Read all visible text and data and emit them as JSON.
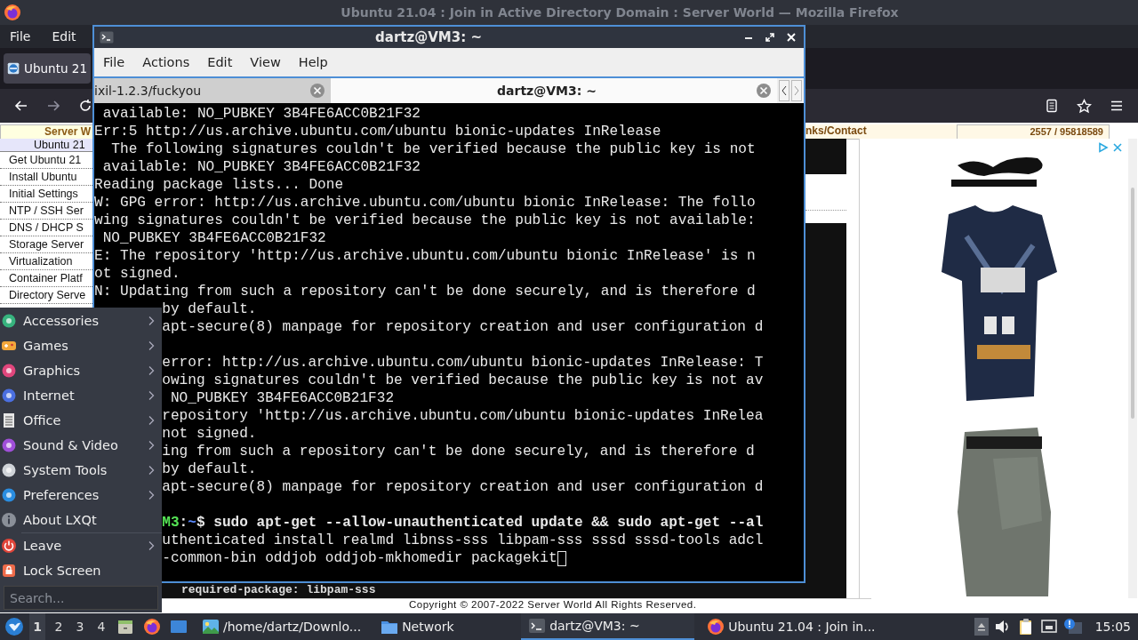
{
  "firefox": {
    "title": "Ubuntu 21.04 : Join in Active Directory Domain : Server World — Mozilla Firefox",
    "menu": [
      "File",
      "Edit"
    ],
    "tabs": [
      {
        "label": "Ubuntu 21",
        "selected": true
      }
    ],
    "page": {
      "header_left": "Server W",
      "header_links": "nks/Contact",
      "header_counter": "2557 / 95818589",
      "nav": [
        {
          "label": "Ubuntu 21",
          "selected": true
        },
        {
          "label": "Get Ubuntu 21",
          "selected": false
        },
        {
          "label": "Install Ubuntu",
          "selected": false
        },
        {
          "label": "Initial Settings",
          "selected": false
        },
        {
          "label": "NTP / SSH Ser",
          "selected": false
        },
        {
          "label": "DNS / DHCP S",
          "selected": false
        },
        {
          "label": "Storage Server",
          "selected": false
        },
        {
          "label": "Virtualization",
          "selected": false
        },
        {
          "label": "Container Platf",
          "selected": false
        },
        {
          "label": "Directory Serve",
          "selected": false
        }
      ],
      "content_line": "required-package: libpam-sss",
      "copyright": "Copyright © 2007-2022 Server World All Rights Reserved."
    }
  },
  "terminal": {
    "title": "dartz@VM3: ~",
    "menu": [
      "File",
      "Actions",
      "Edit",
      "View",
      "Help"
    ],
    "tabs": [
      {
        "label": "ixil-1.2.3/fuckyou",
        "selected": false
      },
      {
        "label": "dartz@VM3: ~",
        "selected": true
      }
    ],
    "lines": [
      {
        "kind": "line",
        "text": " available: NO_PUBKEY 3B4FE6ACC0B21F32"
      },
      {
        "kind": "line",
        "text": "Err:5 http://us.archive.ubuntu.com/ubuntu bionic-updates InRelease"
      },
      {
        "kind": "line",
        "text": "  The following signatures couldn't be verified because the public key is not"
      },
      {
        "kind": "line",
        "text": " available: NO_PUBKEY 3B4FE6ACC0B21F32"
      },
      {
        "kind": "line",
        "text": "Reading package lists... Done"
      },
      {
        "kind": "line",
        "text": "W: GPG error: http://us.archive.ubuntu.com/ubuntu bionic InRelease: The follo"
      },
      {
        "kind": "line",
        "text": "wing signatures couldn't be verified because the public key is not available:"
      },
      {
        "kind": "line",
        "text": " NO_PUBKEY 3B4FE6ACC0B21F32"
      },
      {
        "kind": "line",
        "text": "E: The repository 'http://us.archive.ubuntu.com/ubuntu bionic InRelease' is n"
      },
      {
        "kind": "line",
        "text": "ot signed."
      },
      {
        "kind": "line",
        "text": "N: Updating from such a repository can't be done securely, and is therefore d"
      },
      {
        "kind": "covered",
        "text": "by default."
      },
      {
        "kind": "covered",
        "text": "apt-secure(8) manpage for repository creation and user configuration d"
      },
      {
        "kind": "blank"
      },
      {
        "kind": "covered",
        "text": "error: http://us.archive.ubuntu.com/ubuntu bionic-updates InRelease: T"
      },
      {
        "kind": "covered",
        "text": "owing signatures couldn't be verified because the public key is not av"
      },
      {
        "kind": "covered",
        "text": " NO_PUBKEY 3B4FE6ACC0B21F32"
      },
      {
        "kind": "covered",
        "text": "repository 'http://us.archive.ubuntu.com/ubuntu bionic-updates InRelea"
      },
      {
        "kind": "covered",
        "text": "not signed."
      },
      {
        "kind": "covered",
        "text": "ing from such a repository can't be done securely, and is therefore d"
      },
      {
        "kind": "covered",
        "text": "by default."
      },
      {
        "kind": "covered",
        "text": "apt-secure(8) manpage for repository creation and user configuration d"
      },
      {
        "kind": "blank"
      },
      {
        "kind": "prompt",
        "segments": [
          {
            "text": "M3",
            "color": "#55e355"
          },
          {
            "text": ":",
            "color": "#e8e8e8"
          },
          {
            "text": "~",
            "color": "#5c8bff"
          },
          {
            "text": "$ sudo apt-get --allow-unauthenticated update && sudo apt-get --al",
            "color": "#e8e8e8"
          }
        ]
      },
      {
        "kind": "covered",
        "text": "uthenticated install realmd libnss-sss libpam-sss sssd sssd-tools adcl"
      },
      {
        "kind": "covered",
        "text": "-common-bin oddjob oddjob-mkhomedir packagekit",
        "cursor": true
      }
    ]
  },
  "start_menu": {
    "items": [
      {
        "kind": "entry",
        "label": "Accessories",
        "submenu": true
      },
      {
        "kind": "entry",
        "label": "Games",
        "submenu": true
      },
      {
        "kind": "entry",
        "label": "Graphics",
        "submenu": true
      },
      {
        "kind": "entry",
        "label": "Internet",
        "submenu": true
      },
      {
        "kind": "entry",
        "label": "Office",
        "submenu": true
      },
      {
        "kind": "entry",
        "label": "Sound & Video",
        "submenu": true
      },
      {
        "kind": "entry",
        "label": "System Tools",
        "submenu": true
      },
      {
        "kind": "entry",
        "label": "Preferences",
        "submenu": true
      },
      {
        "kind": "entry",
        "label": "About LXQt",
        "submenu": false
      },
      {
        "kind": "separator"
      },
      {
        "kind": "entry",
        "label": "Leave",
        "submenu": true
      },
      {
        "kind": "entry",
        "label": "Lock Screen",
        "submenu": false
      }
    ],
    "search": {
      "placeholder": "Search..."
    }
  },
  "taskbar": {
    "desktops": [
      {
        "label": "1",
        "selected": true
      },
      {
        "label": "2",
        "selected": false
      },
      {
        "label": "3",
        "selected": false
      },
      {
        "label": "4",
        "selected": false
      }
    ],
    "tasks": [
      {
        "label": "/home/dartz/Downlo...",
        "selected": false
      },
      {
        "label": "Network",
        "selected": false
      },
      {
        "label": "dartz@VM3: ~",
        "selected": true
      },
      {
        "label": "Ubuntu 21.04 : Join in...",
        "selected": false
      }
    ],
    "clock": "15:05"
  }
}
